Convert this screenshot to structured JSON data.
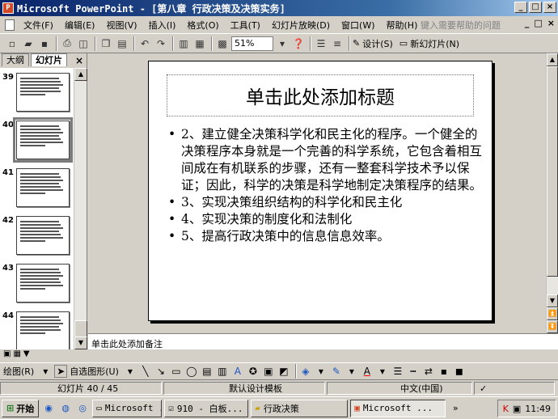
{
  "window": {
    "title": "Microsoft PowerPoint - [第八章 行政决策及决策实务]",
    "controls": [
      "_",
      "□",
      "×"
    ]
  },
  "menubar": {
    "items": [
      "文件(F)",
      "编辑(E)",
      "视图(V)",
      "插入(I)",
      "格式(O)",
      "工具(T)",
      "幻灯片放映(D)",
      "窗口(W)",
      "帮助(H)"
    ],
    "help_placeholder": "键入需要帮助的问题",
    "mdi_controls": [
      "_",
      "□",
      "×"
    ]
  },
  "toolbar": {
    "zoom": "51%",
    "design_label": "设计(S)",
    "new_slide_label": "新幻灯片(N)"
  },
  "left_pane": {
    "tabs": [
      "大纲",
      "幻灯片"
    ],
    "active_tab": "幻灯片",
    "close": "×",
    "thumbnails": [
      {
        "num": "39",
        "lines": 6,
        "selected": false
      },
      {
        "num": "40",
        "lines": 7,
        "selected": true
      },
      {
        "num": "41",
        "lines": 7,
        "selected": false
      },
      {
        "num": "42",
        "lines": 7,
        "selected": false
      },
      {
        "num": "43",
        "lines": 7,
        "selected": false
      },
      {
        "num": "44",
        "lines": 6,
        "selected": false
      }
    ]
  },
  "slide": {
    "title_placeholder": "单击此处添加标题",
    "bullets": [
      "2、建立健全决策科学化和民主化的程序。一个健全的决策程序本身就是一个完善的科学系统，它包含着相互间成在有机联系的步骤，还有一整套科学技术予以保证；因此，科学的决策是科学地制定决策程序的结果。",
      "3、实现决策组织结构的科学化和民主化",
      "4、实现决策的制度化和法制化",
      "5、提高行政决策中的信息信息效率。"
    ]
  },
  "notes": {
    "placeholder": "单击此处添加备注"
  },
  "drawbar": {
    "draw_label": "绘图(R)",
    "autoshapes_label": "自选图形(U)"
  },
  "statusbar": {
    "slide_position": "幻灯片 40 / 45",
    "template": "默认设计模板",
    "language": "中文(中国)"
  },
  "taskbar": {
    "start": "开始",
    "tasks": [
      "Microsoft ...",
      "910 - 白板...",
      "行政决策",
      "Microsoft ..."
    ],
    "active_task_index": 3,
    "clock": "11:49"
  },
  "colors": {
    "title_bar_start": "#0a246a",
    "title_bar_end": "#a6caf0",
    "chrome": "#d4d0c8"
  }
}
